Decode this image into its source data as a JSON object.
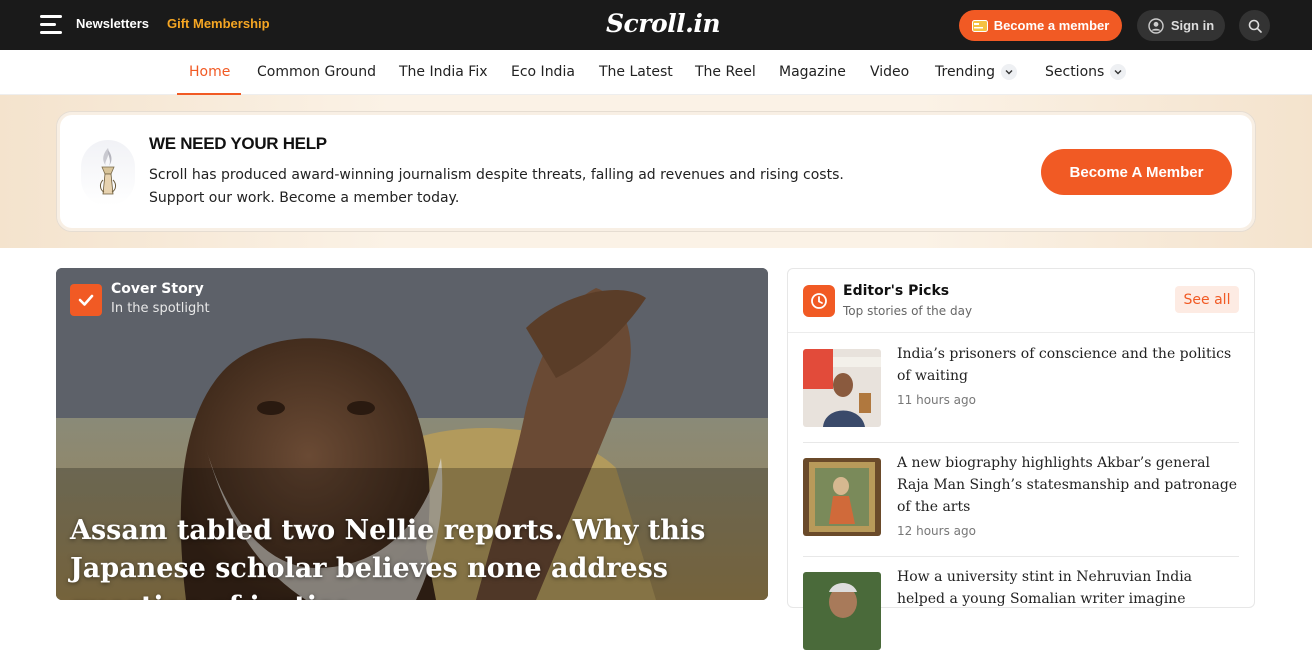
{
  "topbar": {
    "newsletters": "Newsletters",
    "gift_membership": "Gift Membership",
    "logo": "Scroll.in",
    "become_member": "Become a member",
    "sign_in": "Sign in"
  },
  "nav": {
    "items": [
      "Home",
      "Common Ground",
      "The India Fix",
      "Eco India",
      "The Latest",
      "The Reel",
      "Magazine",
      "Video",
      "Trending",
      "Sections"
    ],
    "active": "Home"
  },
  "banner": {
    "title": "WE NEED YOUR HELP",
    "text": "Scroll has produced award-winning journalism despite threats, falling ad revenues and rising costs. Support our work. Become a member today.",
    "button": "Become A Member"
  },
  "hero": {
    "section": "Cover Story",
    "subsection": "In the spotlight",
    "headline": "Assam tabled two Nellie reports. Why this Japanese scholar believes none address question of justice"
  },
  "editors_picks": {
    "title": "Editor's Picks",
    "subtitle": "Top stories of the day",
    "see_all": "See all",
    "items": [
      {
        "headline": "India’s prisoners of conscience and the politics of waiting",
        "time": "11 hours ago"
      },
      {
        "headline": "A new biography highlights Akbar’s general Raja Man Singh’s statesmanship and patronage of the arts",
        "time": "12 hours ago"
      },
      {
        "headline": "How a university stint in Nehruvian India helped a young Somalian writer imagine",
        "time": ""
      }
    ]
  },
  "colors": {
    "accent": "#f15a24",
    "gift": "#f5a623",
    "topbar": "#1a1a1a"
  }
}
